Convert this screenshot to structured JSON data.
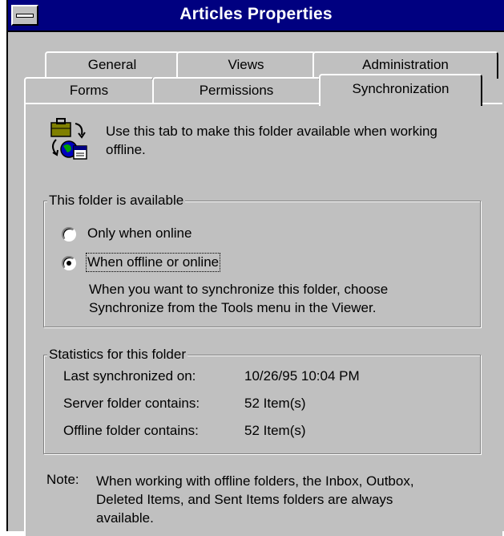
{
  "window": {
    "title": "Articles Properties"
  },
  "tabs": {
    "row1": [
      {
        "label": "General"
      },
      {
        "label": "Views"
      },
      {
        "label": "Administration"
      }
    ],
    "row2": [
      {
        "label": "Forms"
      },
      {
        "label": "Permissions"
      },
      {
        "label": "Synchronization"
      }
    ],
    "active": "Synchronization"
  },
  "intro": {
    "icon": "offline-sync-icon",
    "text": "Use this tab to make this folder available when working offline."
  },
  "availability": {
    "title": "This folder is available",
    "options": [
      {
        "label": "Only when online",
        "checked": false
      },
      {
        "label": "When offline or online",
        "checked": true
      }
    ],
    "hint": "When you want to synchronize this folder, choose Synchronize from the Tools menu in the Viewer."
  },
  "statistics": {
    "title": "Statistics for this folder",
    "rows": [
      {
        "label": "Last synchronized on:",
        "value": "10/26/95 10:04 PM"
      },
      {
        "label": "Server folder contains:",
        "value": "52 Item(s)"
      },
      {
        "label": "Offline folder contains:",
        "value": "52 Item(s)"
      }
    ]
  },
  "note": {
    "label": "Note:",
    "text": "When working with offline folders, the Inbox, Outbox, Deleted Items, and Sent Items folders are always available."
  },
  "colors": {
    "titlebar": "#000080",
    "face": "#c0c0c0"
  }
}
